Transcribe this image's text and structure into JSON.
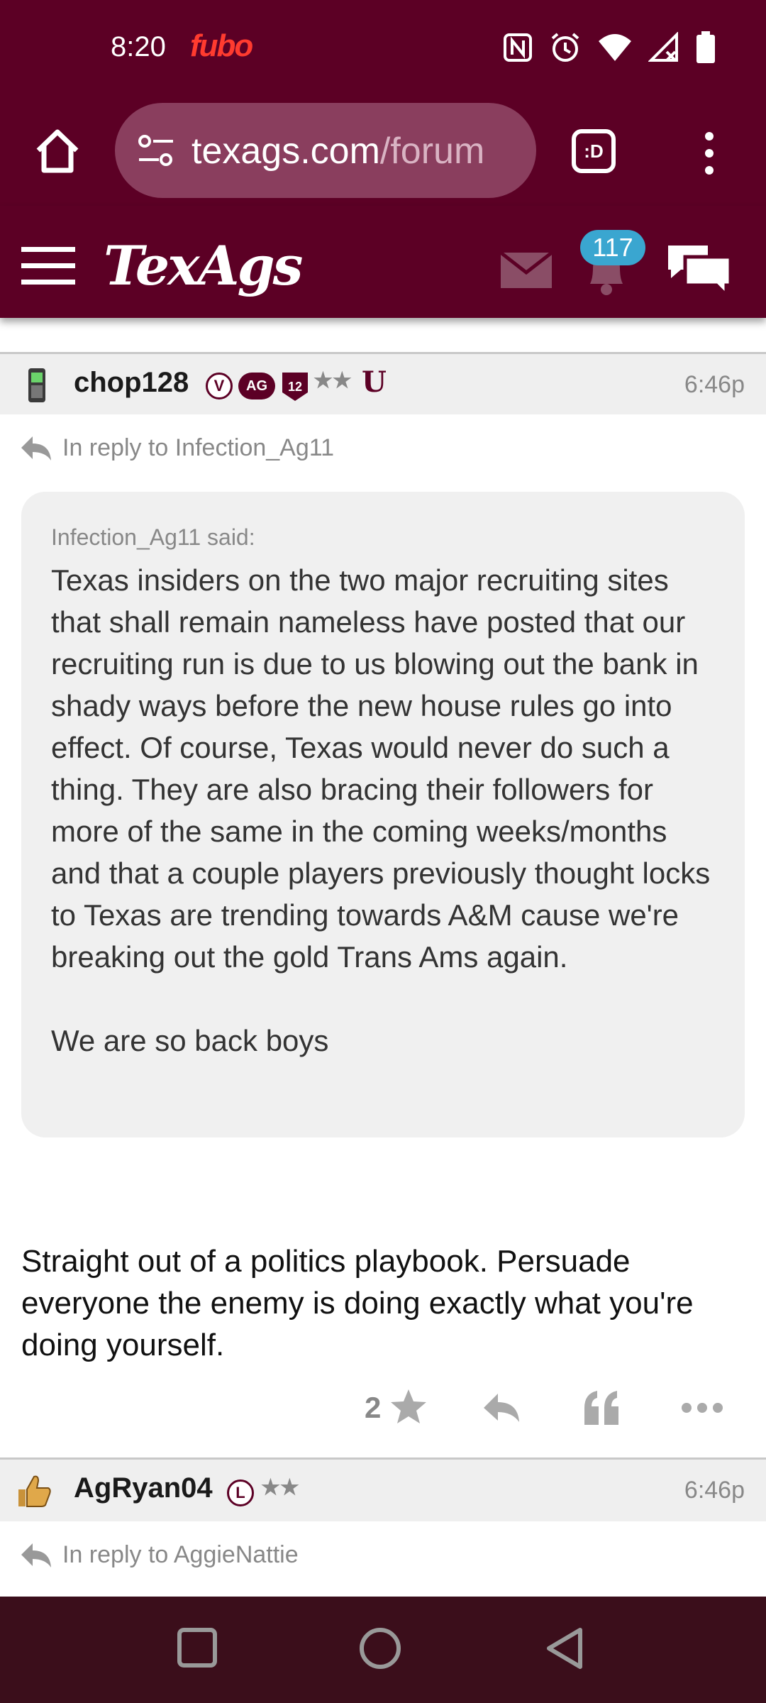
{
  "status_bar": {
    "time": "8:20",
    "app_indicator": "fubo"
  },
  "browser": {
    "url_host": "texags.com",
    "url_path": "/forum",
    "tabs_label": ":D"
  },
  "site": {
    "logo": "TexAgs",
    "notification_count": "117"
  },
  "post1": {
    "username": "chop128",
    "time": "6:46p",
    "badges": {
      "v": "V",
      "ag": "AG",
      "twelve": "12",
      "stars": "★★",
      "u": "U"
    },
    "reply_to": "In reply to Infection_Ag11",
    "quote_author": "Infection_Ag11 said:",
    "quote_text": "Texas insiders on the two major recruiting sites that shall remain nameless have posted that our recruiting run is due to us blowing out the bank in shady ways before the new house rules go into effect. Of course, Texas would never do such a thing. They are also bracing their followers for more of the same in the coming weeks/months and that a couple players previously thought locks to Texas are trending towards A&M cause we're breaking out the gold Trans Ams again.\n\nWe are so back boys",
    "body": "Straight out of a politics playbook. Persuade everyone the enemy is doing exactly what you're doing yourself.",
    "star_count": "2"
  },
  "post2": {
    "username": "AgRyan04",
    "time": "6:46p",
    "badges": {
      "l": "L",
      "stars": "★★"
    },
    "reply_to": "In reply to AggieNattie"
  },
  "colors": {
    "brand_maroon": "#5c0025",
    "badge_blue": "#3aa6d0",
    "nav_bar": "#3b0e1b"
  },
  "icons": [
    "home-icon",
    "tune-icon",
    "tabs-icon",
    "more-vert-icon",
    "hamburger-icon",
    "mail-icon",
    "bell-icon",
    "chat-icon",
    "reply-icon",
    "star-icon",
    "quote-icon",
    "more-horiz-icon",
    "square-icon",
    "circle-icon",
    "back-triangle-icon"
  ]
}
